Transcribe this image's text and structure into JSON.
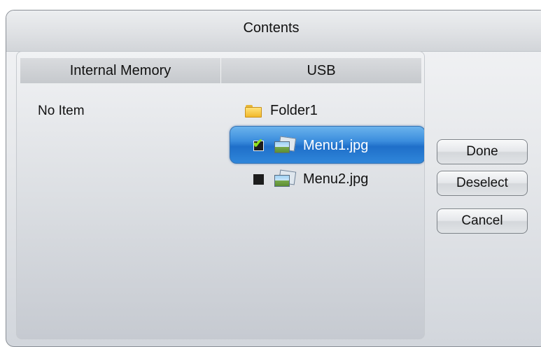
{
  "dialog": {
    "title": "Contents"
  },
  "columns": {
    "left_header": "Internal Memory",
    "right_header": "USB"
  },
  "internal_memory": {
    "empty_text": "No Item"
  },
  "usb": {
    "folder": {
      "label": "Folder1",
      "icon": "folder-icon"
    },
    "files": [
      {
        "label": "Menu1.jpg",
        "checked": true,
        "selected": true,
        "icon": "image-file-icon"
      },
      {
        "label": "Menu2.jpg",
        "checked": false,
        "selected": false,
        "icon": "image-file-icon"
      }
    ]
  },
  "buttons": {
    "done": "Done",
    "deselect": "Deselect",
    "cancel": "Cancel"
  },
  "colors": {
    "selection": "#2f86da",
    "checkmark": "#8fe11e"
  }
}
